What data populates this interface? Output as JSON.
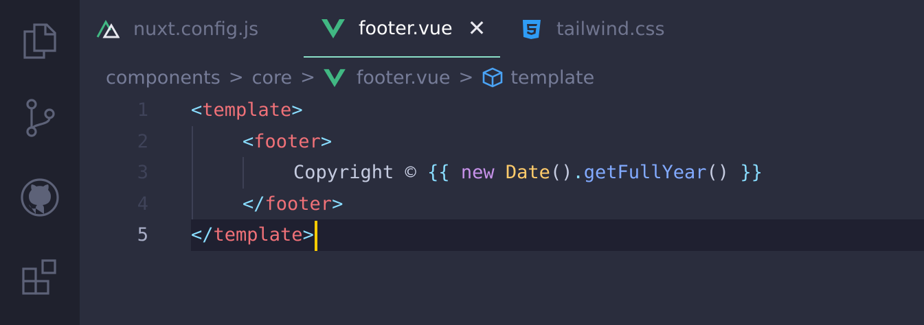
{
  "activity_bar": {
    "items": [
      {
        "icon": "files-icon"
      },
      {
        "icon": "source-control-icon"
      },
      {
        "icon": "github-icon"
      },
      {
        "icon": "extensions-icon"
      }
    ]
  },
  "tabs": [
    {
      "label": "nuxt.config.js",
      "icon": "nuxt-icon",
      "active": false
    },
    {
      "label": "footer.vue",
      "icon": "vue-icon",
      "active": true,
      "close": "✕"
    },
    {
      "label": "tailwind.css",
      "icon": "css-icon",
      "active": false
    }
  ],
  "breadcrumb": {
    "parts": [
      "components",
      "core",
      "footer.vue",
      "template"
    ],
    "separator": ">"
  },
  "code": {
    "line_numbers": [
      "1",
      "2",
      "3",
      "4",
      "5"
    ],
    "lines": {
      "l1": {
        "open": "<",
        "tag": "template",
        "close": ">"
      },
      "l2": {
        "open": "<",
        "tag": "footer",
        "close": ">"
      },
      "l3": {
        "text": "Copyright © ",
        "mustache_open": "{{",
        "kw": "new",
        "cls": "Date",
        "paren1": "()",
        "dot": ".",
        "fn": "getFullYear",
        "paren2": "()",
        "mustache_close": "}}"
      },
      "l4": {
        "open": "</",
        "tag": "footer",
        "close": ">"
      },
      "l5": {
        "open": "</",
        "tag": "template",
        "close": ">"
      }
    }
  },
  "colors": {
    "accent": "#8be0c8",
    "cursor": "#ffcc00",
    "vue": "#41b883",
    "css": "#2f9cf5"
  }
}
